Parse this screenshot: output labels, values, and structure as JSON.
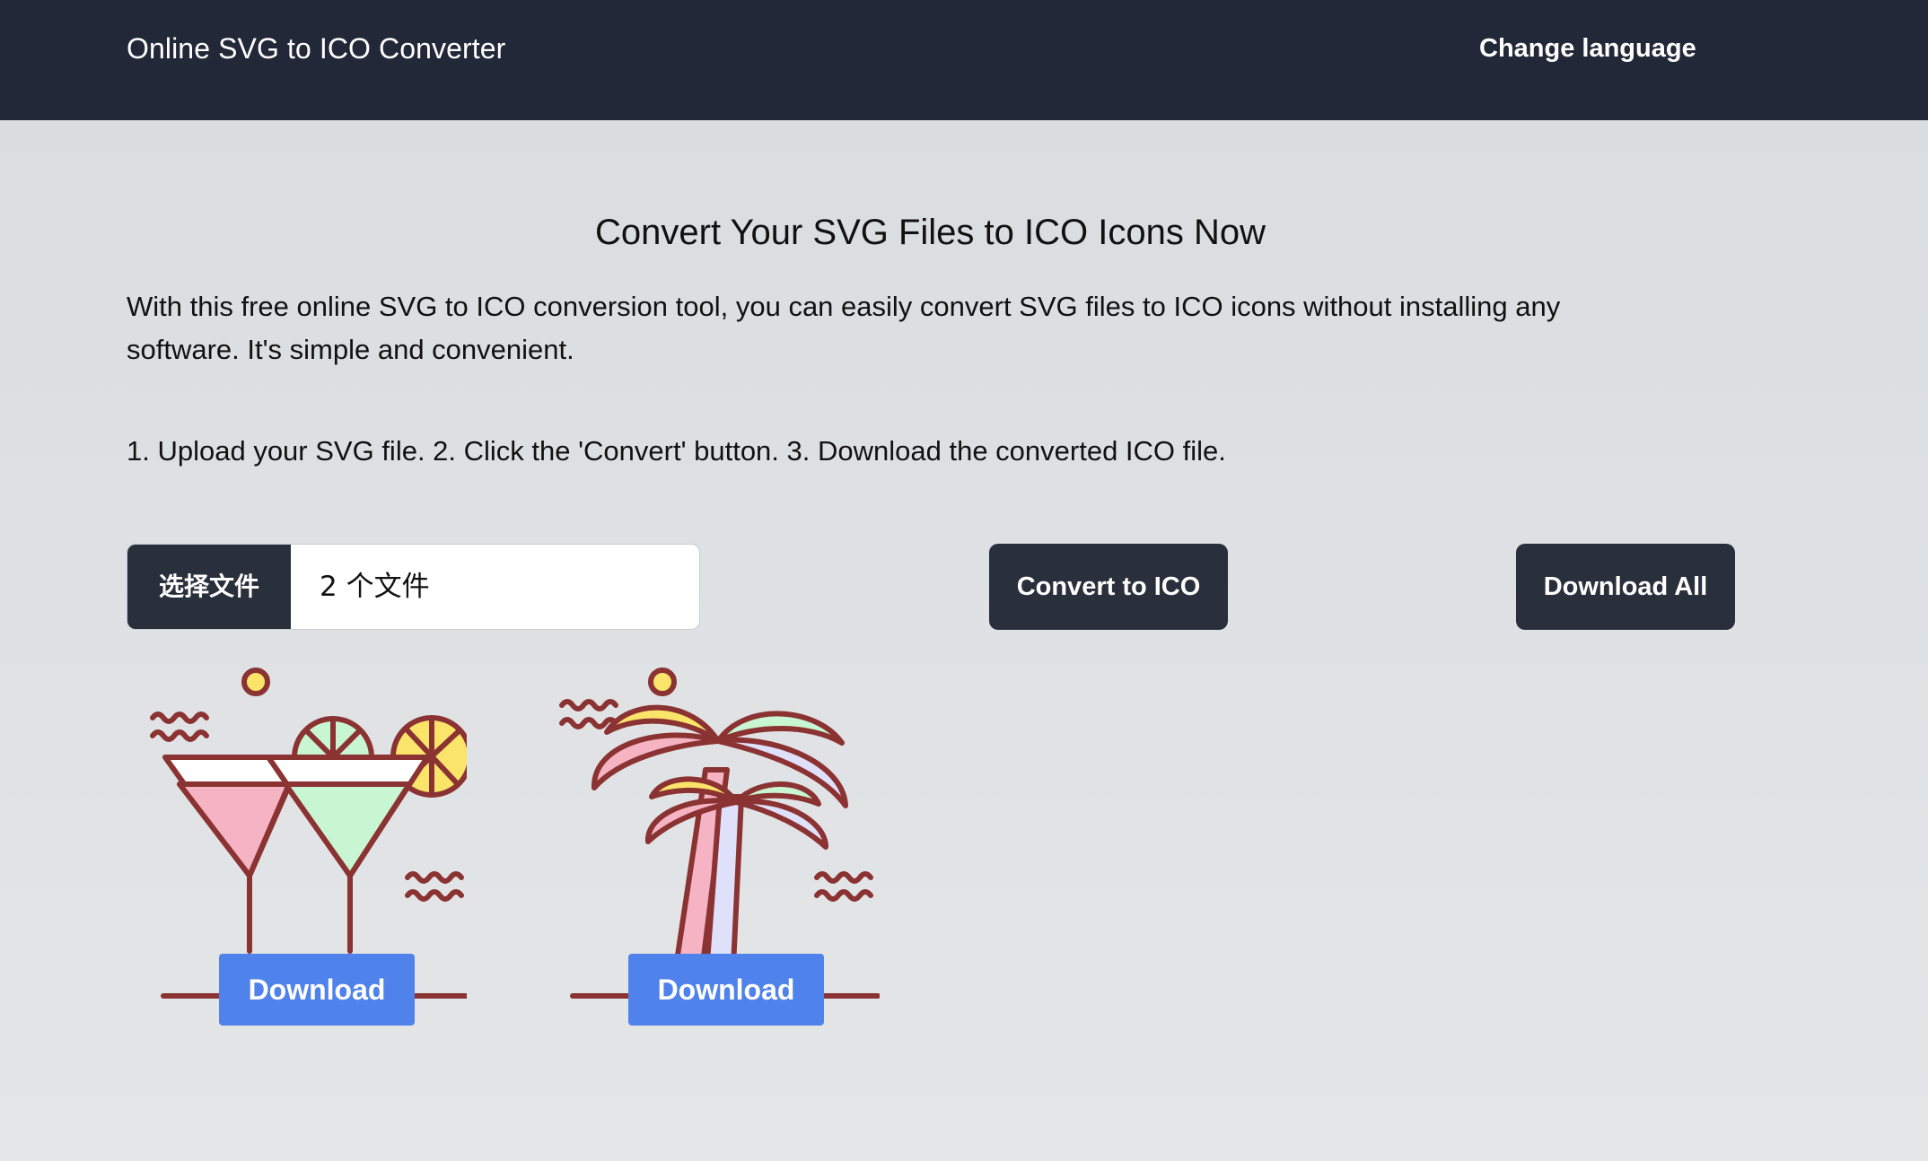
{
  "header": {
    "brand": "Online SVG to ICO Converter",
    "change_language": "Change language"
  },
  "main": {
    "title": "Convert Your SVG Files to ICO Icons Now",
    "intro": "With this free online SVG to ICO conversion tool, you can easily convert SVG files to ICO icons without installing any software. It's simple and convenient.",
    "steps": "1. Upload your SVG file. 2. Click the 'Convert' button. 3. Download the converted ICO file."
  },
  "upload": {
    "choose_label": "选择文件",
    "status": "2 个文件"
  },
  "actions": {
    "convert_label": "Convert to ICO",
    "download_all_label": "Download All"
  },
  "previews": [
    {
      "icon": "cocktail-glasses-icon",
      "download_label": "Download"
    },
    {
      "icon": "palm-tree-icon",
      "download_label": "Download"
    }
  ],
  "colors": {
    "navbar": "#222838",
    "dark_button": "#2a2f3c",
    "download_button": "#4f82ea",
    "illustration_stroke": "#8b3232",
    "pink": "#f5b3c3",
    "mint": "#c8f5d2",
    "yellow": "#fbe46a",
    "lavender": "#dfe0fa"
  }
}
